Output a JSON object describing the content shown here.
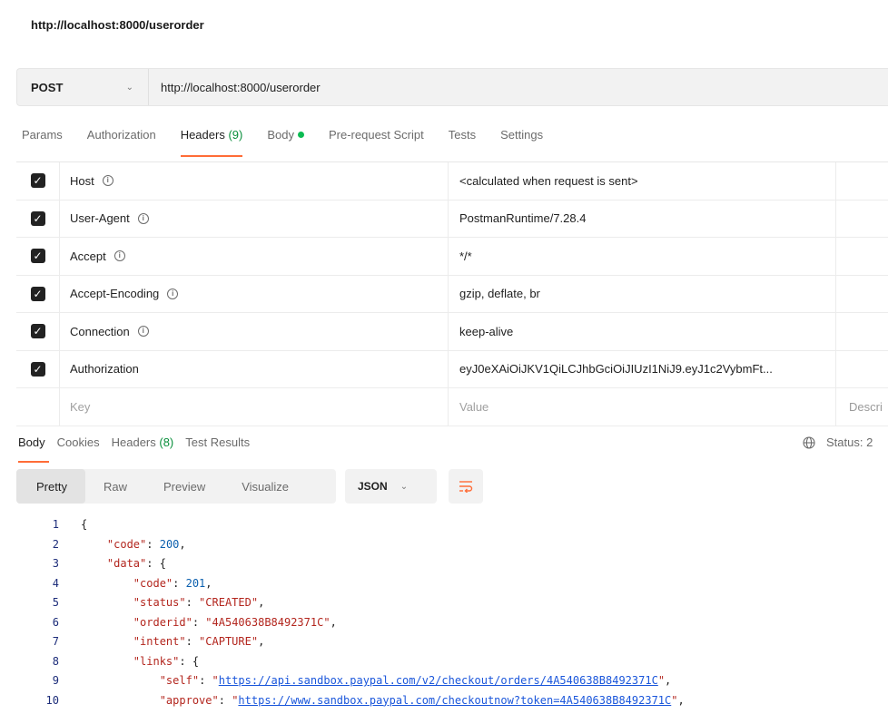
{
  "request": {
    "title": "http://localhost:8000/userorder",
    "method": "POST",
    "url": "http://localhost:8000/userorder"
  },
  "request_tabs": [
    {
      "label": "Params"
    },
    {
      "label": "Authorization"
    },
    {
      "label": "Headers",
      "count": "(9)"
    },
    {
      "label": "Body"
    },
    {
      "label": "Pre-request Script"
    },
    {
      "label": "Tests"
    },
    {
      "label": "Settings"
    }
  ],
  "headers": [
    {
      "key": "Host",
      "value": "<calculated when request is sent>",
      "info": true
    },
    {
      "key": "User-Agent",
      "value": "PostmanRuntime/7.28.4",
      "info": true
    },
    {
      "key": "Accept",
      "value": "*/*",
      "info": true
    },
    {
      "key": "Accept-Encoding",
      "value": "gzip, deflate, br",
      "info": true
    },
    {
      "key": "Connection",
      "value": "keep-alive",
      "info": true
    },
    {
      "key": "Authorization",
      "value": "eyJ0eXAiOiJKV1QiLCJhbGciOiJIUzI1NiJ9.eyJ1c2VybmFt...",
      "info": false
    }
  ],
  "headers_placeholder": {
    "key": "Key",
    "value": "Value",
    "description": "Descri"
  },
  "response_tabs": [
    {
      "label": "Body"
    },
    {
      "label": "Cookies"
    },
    {
      "label": "Headers",
      "count": "(8)"
    },
    {
      "label": "Test Results"
    }
  ],
  "status_label": "Status: 2",
  "view_modes": [
    "Pretty",
    "Raw",
    "Preview",
    "Visualize"
  ],
  "format": "JSON",
  "code_lines": [
    {
      "n": "1",
      "text": "{"
    },
    {
      "n": "2",
      "text": "    \"code\": 200,"
    },
    {
      "n": "3",
      "text": "    \"data\": {"
    },
    {
      "n": "4",
      "text": "        \"code\": 201,"
    },
    {
      "n": "5",
      "text": "        \"status\": \"CREATED\","
    },
    {
      "n": "6",
      "text": "        \"orderid\": \"4A540638B8492371C\","
    },
    {
      "n": "7",
      "text": "        \"intent\": \"CAPTURE\","
    },
    {
      "n": "8",
      "text": "        \"links\": {"
    },
    {
      "n": "9",
      "text": "            \"self\": \"https://api.sandbox.paypal.com/v2/checkout/orders/4A540638B8492371C\","
    },
    {
      "n": "10",
      "text": "            \"approve\": \"https://www.sandbox.paypal.com/checkoutnow?token=4A540638B8492371C\","
    }
  ],
  "colors": {
    "accent": "#ff6c37",
    "count_green": "#0a8f3c",
    "dot_green": "#0cbb52"
  },
  "icons": {
    "info": "info-circle-icon",
    "globe": "globe-icon",
    "wrap": "wrap-lines-icon",
    "checkbox": "checkbox-checked-icon"
  }
}
